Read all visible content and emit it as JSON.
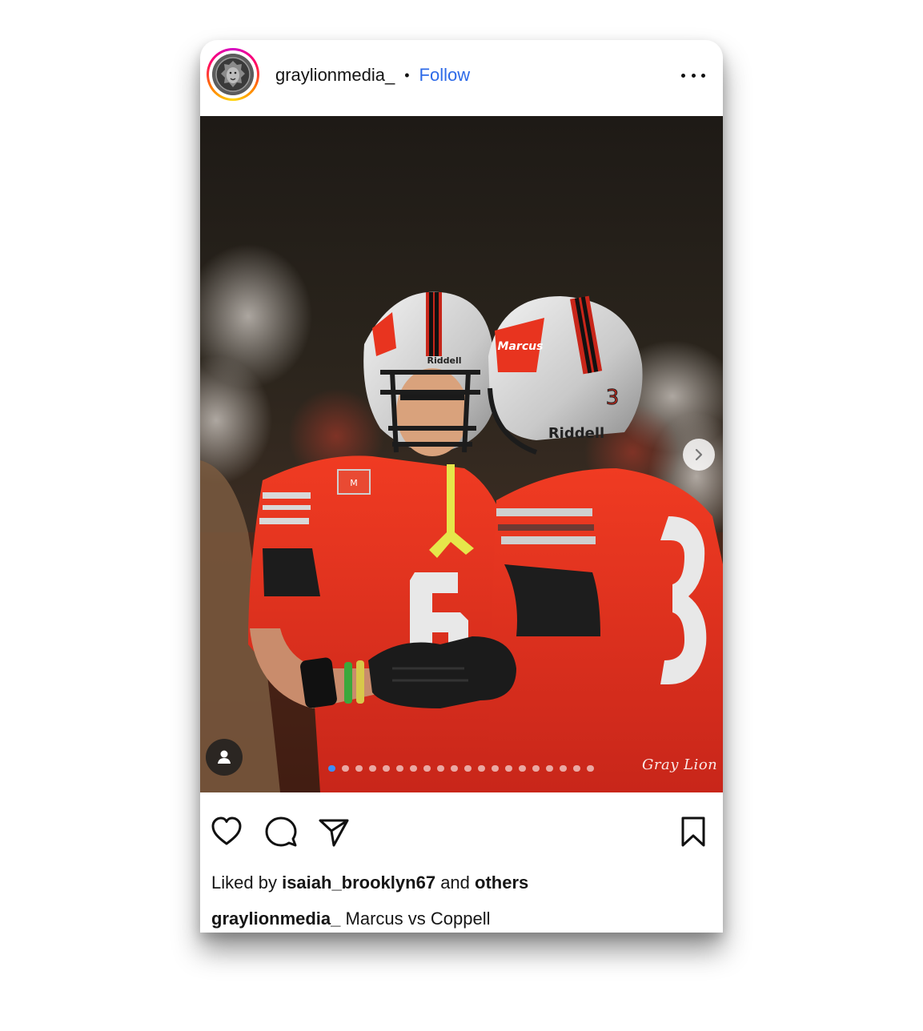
{
  "post": {
    "username": "graylionmedia_",
    "separator": "•",
    "follow_label": "Follow",
    "more_icon": "more-horizontal-icon",
    "avatar_icon": "lion-logo",
    "photo": {
      "description_icon": "football-players-photo",
      "watermark": "Gray Lion",
      "carousel_total": 20,
      "carousel_active_index": 0,
      "next_icon": "chevron-right-icon",
      "tag_icon": "user-tag-icon"
    },
    "actions": {
      "like_icon": "heart-icon",
      "comment_icon": "comment-icon",
      "share_icon": "send-icon",
      "save_icon": "bookmark-icon"
    },
    "likes": {
      "prefix": "Liked by",
      "user": "isaiah_brooklyn67",
      "joiner": "and",
      "others": "others"
    },
    "caption": {
      "username": "graylionmedia_",
      "text": "Marcus vs Coppell"
    }
  },
  "colors": {
    "link": "#2d6ae8",
    "jersey_red": "#e8341f",
    "active_dot": "#3e8ef7"
  }
}
